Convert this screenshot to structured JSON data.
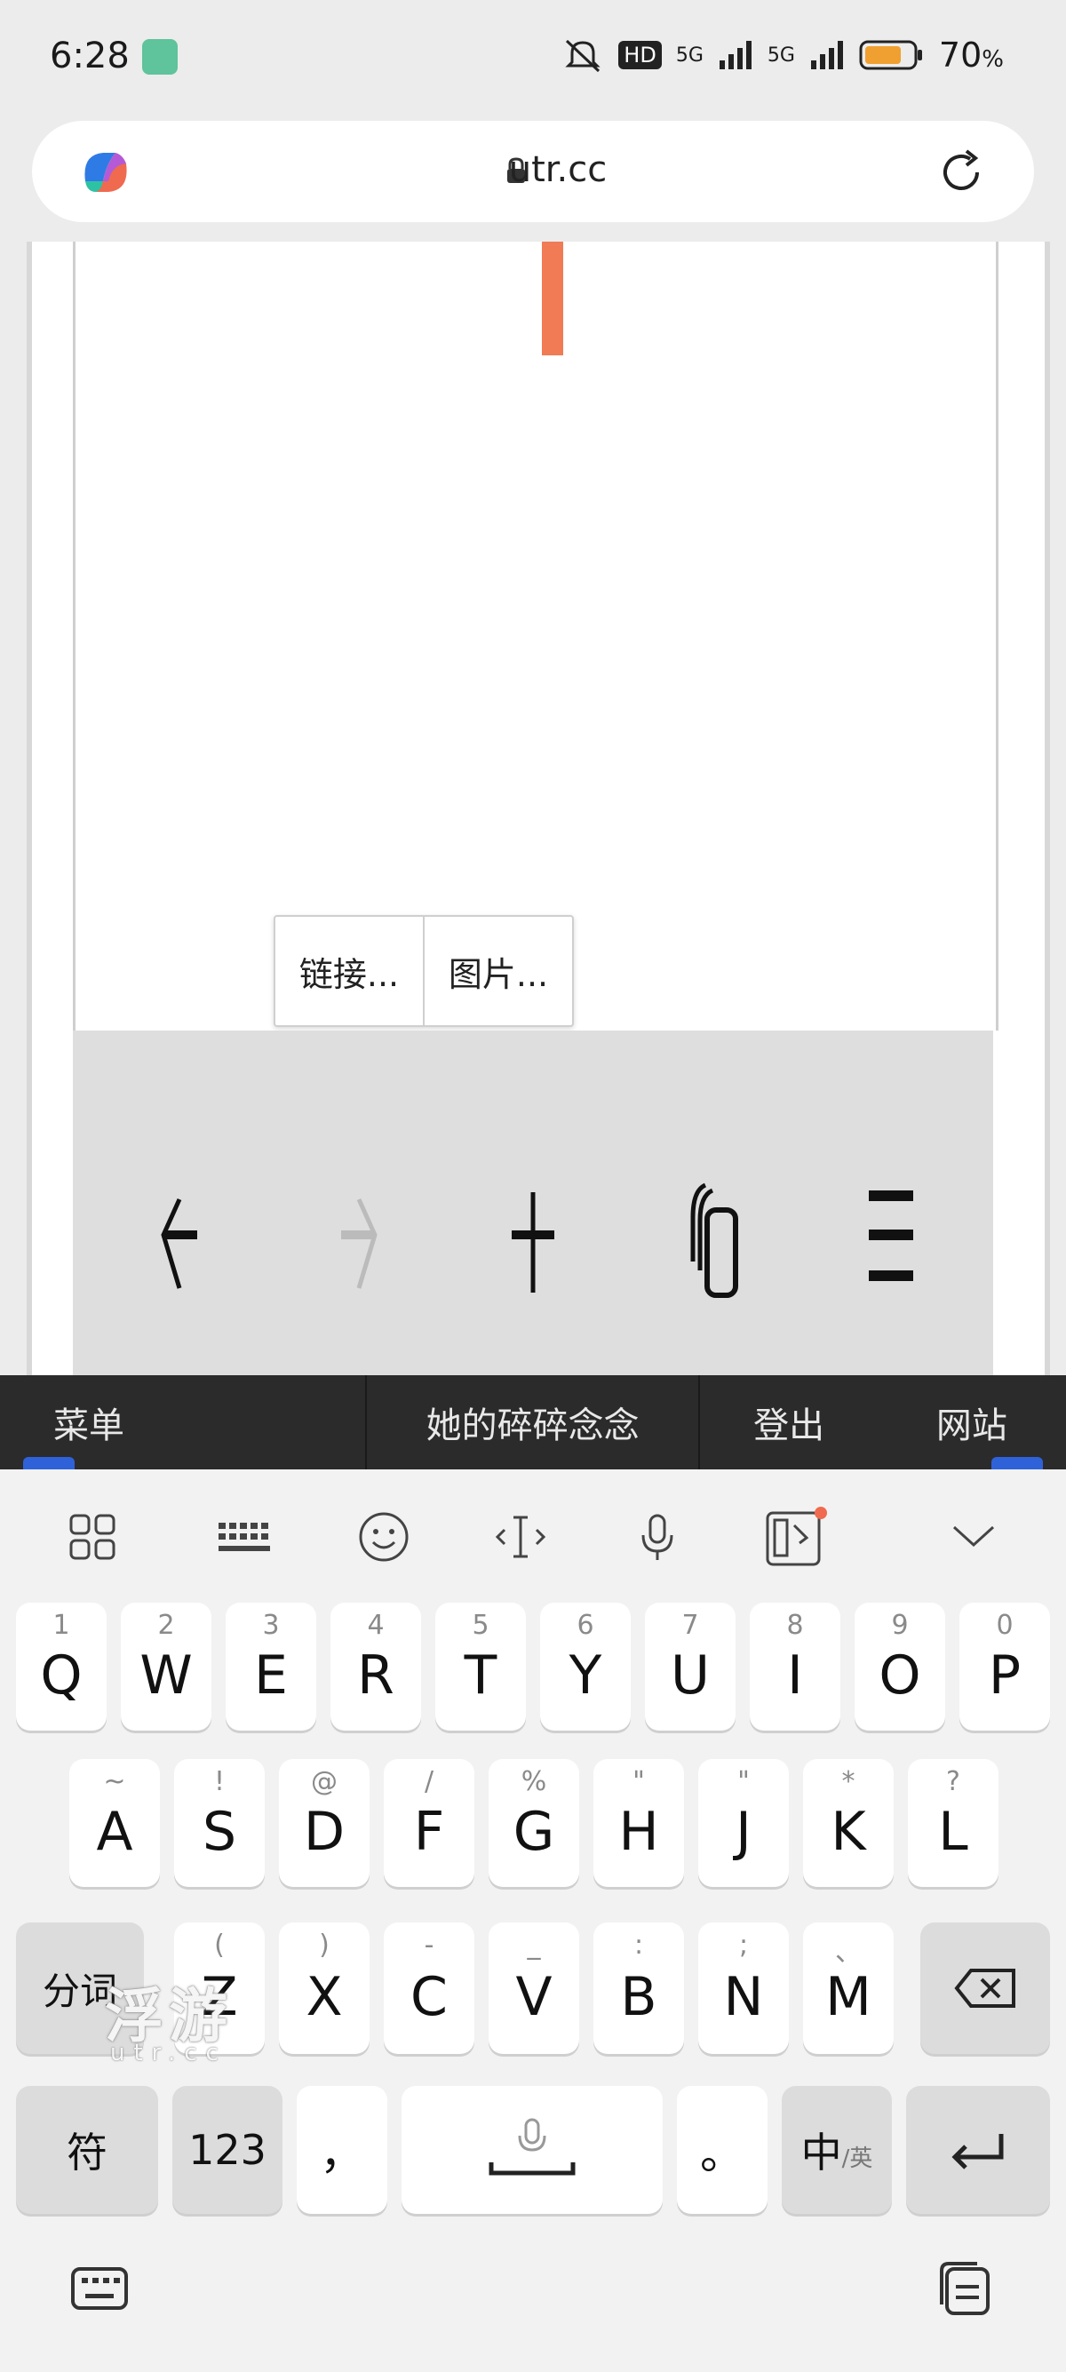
{
  "status": {
    "time": "6:28",
    "signal_labels": [
      "HD",
      "5G",
      "5G"
    ],
    "battery": "70",
    "battery_unit": "%"
  },
  "browser": {
    "url": "utr.cc"
  },
  "popup": {
    "items": [
      "链接...",
      "图片..."
    ]
  },
  "menu_bar": {
    "items": [
      "菜单",
      "她的碎碎念念",
      "登出",
      "网站"
    ]
  },
  "keyboard": {
    "row1": [
      {
        "key": "Q",
        "hint": "1"
      },
      {
        "key": "W",
        "hint": "2"
      },
      {
        "key": "E",
        "hint": "3"
      },
      {
        "key": "R",
        "hint": "4"
      },
      {
        "key": "T",
        "hint": "5"
      },
      {
        "key": "Y",
        "hint": "6"
      },
      {
        "key": "U",
        "hint": "7"
      },
      {
        "key": "I",
        "hint": "8"
      },
      {
        "key": "O",
        "hint": "9"
      },
      {
        "key": "P",
        "hint": "0"
      }
    ],
    "row2": [
      {
        "key": "A",
        "hint": "~"
      },
      {
        "key": "S",
        "hint": "!"
      },
      {
        "key": "D",
        "hint": "@"
      },
      {
        "key": "F",
        "hint": "/"
      },
      {
        "key": "G",
        "hint": "%"
      },
      {
        "key": "H",
        "hint": "\""
      },
      {
        "key": "J",
        "hint": "\""
      },
      {
        "key": "K",
        "hint": "*"
      },
      {
        "key": "L",
        "hint": "?"
      }
    ],
    "row3": [
      {
        "key": "Z",
        "hint": "("
      },
      {
        "key": "X",
        "hint": ")"
      },
      {
        "key": "C",
        "hint": "-"
      },
      {
        "key": "V",
        "hint": "_"
      },
      {
        "key": "B",
        "hint": ":"
      },
      {
        "key": "N",
        "hint": ";"
      },
      {
        "key": "M",
        "hint": "、"
      }
    ],
    "segment_key": "分词",
    "symbol_key": "符",
    "number_key": "123",
    "comma_key": "，",
    "period_key": "。",
    "lang_key_main": "中",
    "lang_key_sub": "/英"
  },
  "watermark": {
    "main": "浮游",
    "sub": "utr.cc"
  }
}
